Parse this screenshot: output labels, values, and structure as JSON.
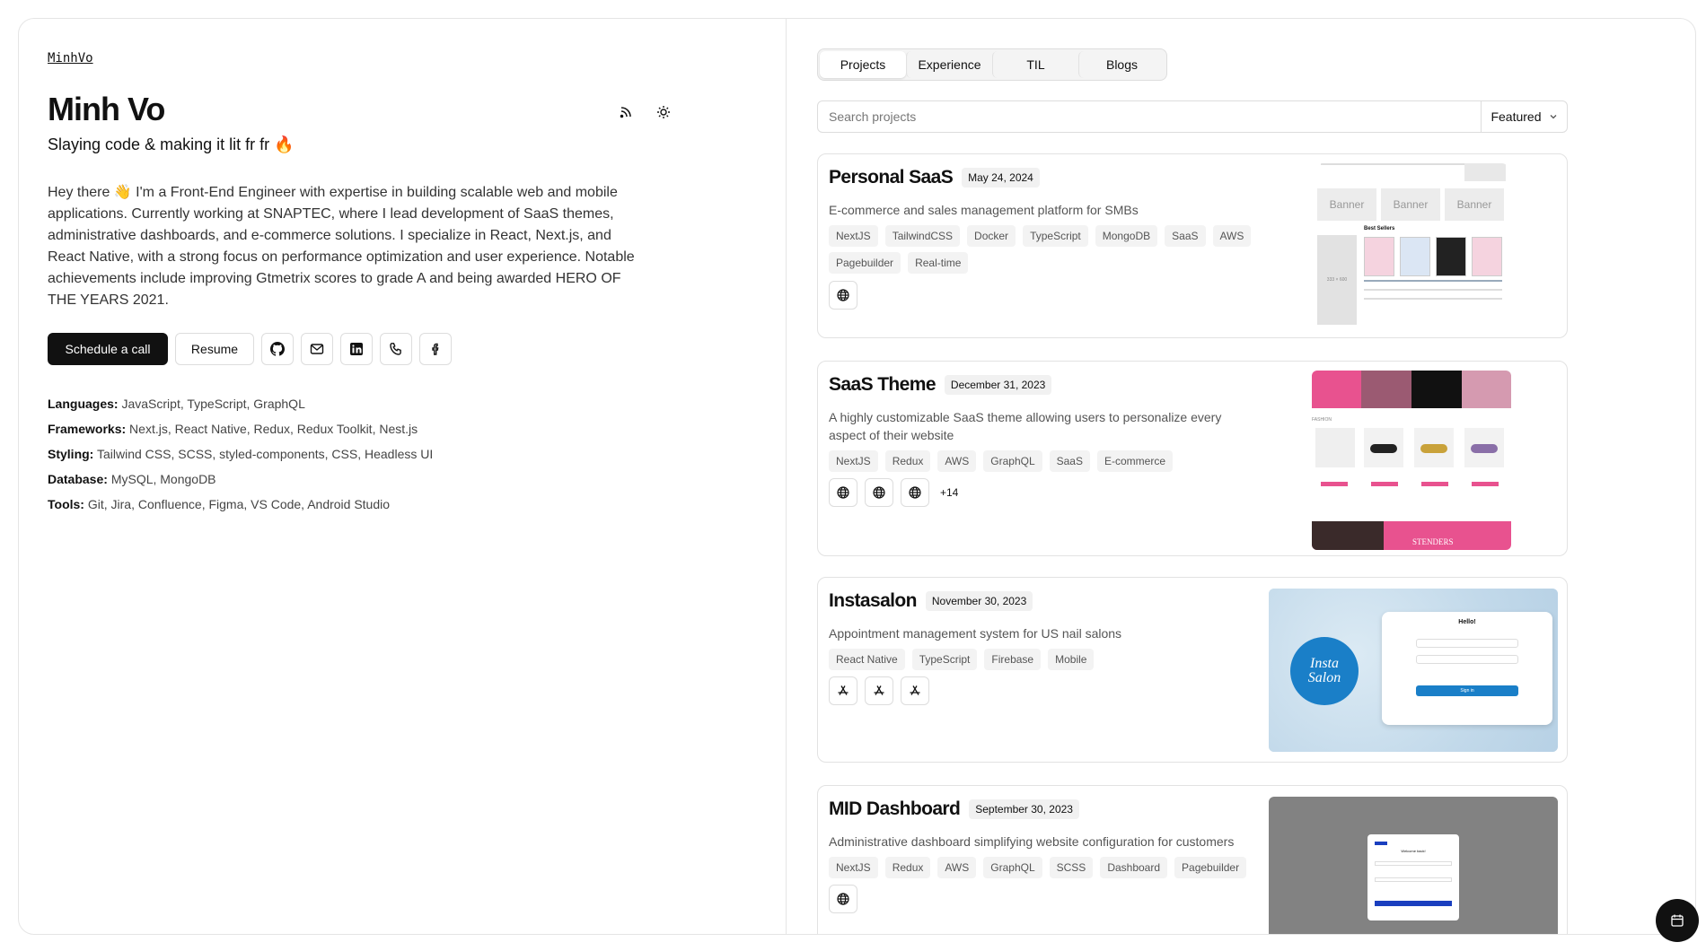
{
  "profile": {
    "handle": "MinhVo",
    "name": "Minh Vo",
    "tagline": "Slaying code & making it lit fr fr 🔥",
    "bio": "Hey there 👋 I'm a Front-End Engineer with expertise in building scalable web and mobile applications. Currently working at SNAPTEC, where I lead development of SaaS themes, administrative dashboards, and e-commerce solutions. I specialize in React, Next.js, and React Native, with a strong focus on performance optimization and user experience. Notable achievements include improving Gtmetrix scores to grade A and being awarded HERO OF THE YEARS 2021.",
    "schedule_label": "Schedule a call",
    "resume_label": "Resume",
    "skills": [
      {
        "label": "Languages:",
        "value": "JavaScript, TypeScript, GraphQL"
      },
      {
        "label": "Frameworks:",
        "value": "Next.js, React Native, Redux, Redux Toolkit, Nest.js"
      },
      {
        "label": "Styling:",
        "value": "Tailwind CSS, SCSS, styled-components, CSS, Headless UI"
      },
      {
        "label": "Database:",
        "value": "MySQL, MongoDB"
      },
      {
        "label": "Tools:",
        "value": "Git, Jira, Confluence, Figma, VS Code, Android Studio"
      }
    ]
  },
  "tabs": [
    "Projects",
    "Experience",
    "TIL",
    "Blogs"
  ],
  "search": {
    "placeholder": "Search projects",
    "sort": "Featured"
  },
  "projects": [
    {
      "title": "Personal SaaS",
      "date": "May 24, 2024",
      "description": "E-commerce and sales management platform for SMBs",
      "tags": [
        "NextJS",
        "TailwindCSS",
        "Docker",
        "TypeScript",
        "MongoDB",
        "SaaS",
        "AWS",
        "Pagebuilder",
        "Real-time"
      ],
      "banner_labels": [
        "Banner",
        "Banner",
        "Banner"
      ],
      "best_sellers": "Best Sellers",
      "placeholder_size": "333 × 600"
    },
    {
      "title": "SaaS Theme",
      "date": "December 31, 2023",
      "description": "A highly customizable SaaS theme allowing users to personalize every aspect of their website",
      "tags": [
        "NextJS",
        "Redux",
        "AWS",
        "GraphQL",
        "SaaS",
        "E-commerce"
      ],
      "more": "+14",
      "fashion_label": "FASHION",
      "stenders_label": "STENDERS"
    },
    {
      "title": "Instasalon",
      "date": "November 30, 2023",
      "description": "Appointment management system for US nail salons",
      "tags": [
        "React Native",
        "TypeScript",
        "Firebase",
        "Mobile"
      ],
      "logo_text": "Insta Salon",
      "hello": "Hello!",
      "sign_in": "Sign in"
    },
    {
      "title": "MID Dashboard",
      "date": "September 30, 2023",
      "description": "Administrative dashboard simplifying website configuration for customers",
      "tags": [
        "NextJS",
        "Redux",
        "AWS",
        "GraphQL",
        "SCSS",
        "Dashboard",
        "Pagebuilder"
      ],
      "welcome": "Welcome back!"
    }
  ]
}
